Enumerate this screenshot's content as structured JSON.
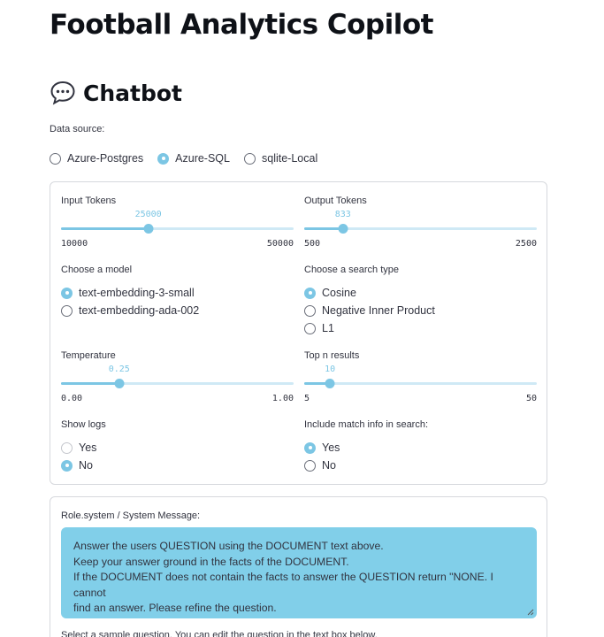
{
  "header": {
    "app_title": "Football Analytics Copilot",
    "section_title": "Chatbot",
    "section_icon": "speech-bubble-icon"
  },
  "data_source": {
    "label": "Data source:",
    "options": [
      "Azure-Postgres",
      "Azure-SQL",
      "sqlite-Local"
    ],
    "selected": "Azure-SQL"
  },
  "settings": {
    "input_tokens": {
      "label": "Input Tokens",
      "value": "25000",
      "min": "10000",
      "max": "50000",
      "fraction": 0.375
    },
    "output_tokens": {
      "label": "Output Tokens",
      "value": "833",
      "min": "500",
      "max": "2500",
      "fraction": 0.1665
    },
    "model": {
      "label": "Choose a model",
      "options": [
        "text-embedding-3-small",
        "text-embedding-ada-002"
      ],
      "selected": "text-embedding-3-small"
    },
    "search_type": {
      "label": "Choose a search type",
      "options": [
        "Cosine",
        "Negative Inner Product",
        "L1"
      ],
      "selected": "Cosine"
    },
    "temperature": {
      "label": "Temperature",
      "value": "0.25",
      "min": "0.00",
      "max": "1.00",
      "fraction": 0.25
    },
    "top_n": {
      "label": "Top n results",
      "value": "10",
      "min": "5",
      "max": "50",
      "fraction": 0.111
    },
    "show_logs": {
      "label": "Show logs",
      "options": [
        "Yes",
        "No"
      ],
      "selected": "No"
    },
    "include_match_info": {
      "label": "Include match info in search:",
      "options": [
        "Yes",
        "No"
      ],
      "selected": "Yes"
    }
  },
  "system_message": {
    "label": "Role.system / System Message:",
    "lines": [
      "Answer the users QUESTION using the DOCUMENT text above.",
      "Keep your answer ground in the facts of the DOCUMENT.",
      "If the DOCUMENT does not contain the facts to answer the QUESTION return \"NONE. I cannot",
      "find an answer. Please refine the question."
    ]
  },
  "sample_question_label": "Select a sample question. You can edit the question in the text box below.",
  "colors": {
    "accent": "#7cc6e4",
    "track": "#cfe9f5",
    "textarea_bg": "#81cfe9",
    "border": "#d6d8dd"
  }
}
